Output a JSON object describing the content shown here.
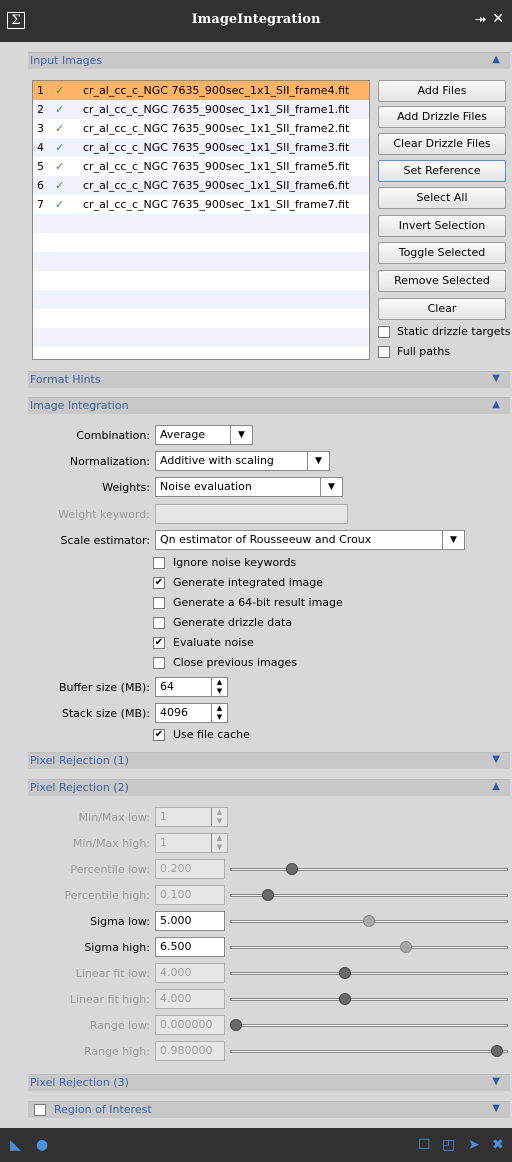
{
  "window": {
    "title": "ImageIntegration"
  },
  "titlebar_icons": {
    "sigma": "Σ",
    "collapse": "⯮",
    "close": "✕"
  },
  "sections": {
    "input_images": "Input Images",
    "format_hints": "Format Hints",
    "image_integration": "Image Integration",
    "pixel_rejection_1": "Pixel Rejection (1)",
    "pixel_rejection_2": "Pixel Rejection (2)",
    "pixel_rejection_3": "Pixel Rejection (3)",
    "region_of_interest": "Region of Interest"
  },
  "files": [
    {
      "num": "1",
      "name": "cr_al_cc_c_NGC 7635_900sec_1x1_SII_frame4.fit"
    },
    {
      "num": "2",
      "name": "cr_al_cc_c_NGC 7635_900sec_1x1_SII_frame1.fit"
    },
    {
      "num": "3",
      "name": "cr_al_cc_c_NGC 7635_900sec_1x1_SII_frame2.fit"
    },
    {
      "num": "4",
      "name": "cr_al_cc_c_NGC 7635_900sec_1x1_SII_frame3.fit"
    },
    {
      "num": "5",
      "name": "cr_al_cc_c_NGC 7635_900sec_1x1_SII_frame5.fit"
    },
    {
      "num": "6",
      "name": "cr_al_cc_c_NGC 7635_900sec_1x1_SII_frame6.fit"
    },
    {
      "num": "7",
      "name": "cr_al_cc_c_NGC 7635_900sec_1x1_SII_frame7.fit"
    }
  ],
  "file_buttons": {
    "add_files": "Add Files",
    "add_drizzle": "Add Drizzle Files",
    "clear_drizzle": "Clear Drizzle Files",
    "set_reference": "Set Reference",
    "select_all": "Select All",
    "invert_selection": "Invert Selection",
    "toggle_selected": "Toggle Selected",
    "remove_selected": "Remove Selected",
    "clear": "Clear",
    "static_drizzle": "Static drizzle targets",
    "full_paths": "Full paths"
  },
  "integration": {
    "combination_label": "Combination:",
    "combination_value": "Average",
    "normalization_label": "Normalization:",
    "normalization_value": "Additive with scaling",
    "weights_label": "Weights:",
    "weights_value": "Noise evaluation",
    "weight_keyword_label": "Weight keyword:",
    "scale_estimator_label": "Scale estimator:",
    "scale_estimator_value": "Qn estimator of Rousseeuw and Croux",
    "checks": [
      {
        "label": "Ignore noise keywords",
        "checked": false
      },
      {
        "label": "Generate integrated image",
        "checked": true
      },
      {
        "label": "Generate a 64-bit result image",
        "checked": false
      },
      {
        "label": "Generate drizzle data",
        "checked": false
      },
      {
        "label": "Evaluate noise",
        "checked": true
      },
      {
        "label": "Close previous images",
        "checked": false
      }
    ],
    "buffer_label": "Buffer size (MB):",
    "buffer_value": "64",
    "stack_label": "Stack size (MB):",
    "stack_value": "4096",
    "file_cache_label": "Use file cache"
  },
  "rejection2": {
    "minmax_low_label": "Min/Max low:",
    "minmax_low": "1",
    "minmax_high_label": "Min/Max high:",
    "minmax_high": "1",
    "sliders": [
      {
        "label": "Percentile low:",
        "value": "0.200",
        "pos": 0.21,
        "enabled": false
      },
      {
        "label": "Percentile high:",
        "value": "0.100",
        "pos": 0.12,
        "enabled": false
      },
      {
        "label": "Sigma low:",
        "value": "5.000",
        "pos": 0.5,
        "enabled": true
      },
      {
        "label": "Sigma high:",
        "value": "6.500",
        "pos": 0.64,
        "enabled": true
      },
      {
        "label": "Linear fit low:",
        "value": "4.000",
        "pos": 0.41,
        "enabled": false
      },
      {
        "label": "Linear fit high:",
        "value": "4.000",
        "pos": 0.41,
        "enabled": false
      },
      {
        "label": "Range low:",
        "value": "0.000000",
        "pos": 0.0,
        "enabled": false
      },
      {
        "label": "Range high:",
        "value": "0.980000",
        "pos": 0.98,
        "enabled": false
      }
    ]
  },
  "colors": {
    "accent": "#3c63a8",
    "selected_row": "#ffb366",
    "check_green": "#2a9a2a",
    "titlebar": "#313131"
  }
}
